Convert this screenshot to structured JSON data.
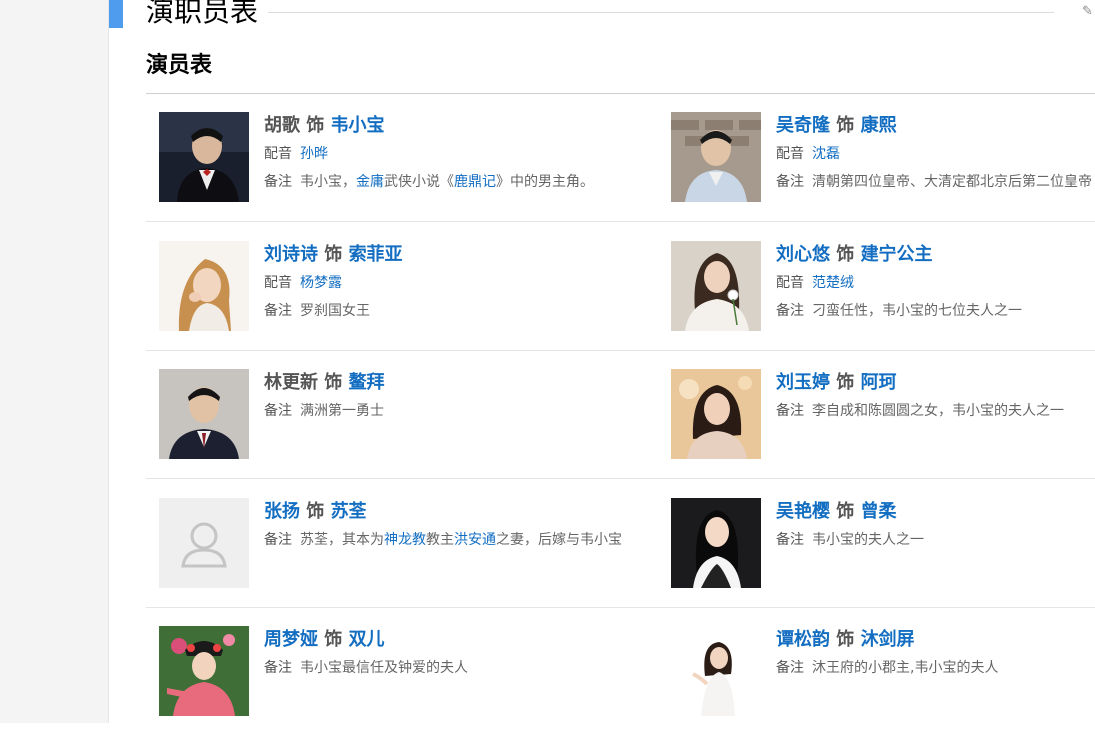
{
  "section": {
    "title": "演职员表",
    "subtitle": "演员表"
  },
  "labels": {
    "dub": "配音",
    "note": "备注",
    "plays": "饰"
  },
  "colors": {
    "link": "#136ec2",
    "accent": "#4f9cee"
  },
  "cast": [
    {
      "actor": "胡歌",
      "role": "韦小宝",
      "dub": "孙晔",
      "note": [
        "韦小宝，",
        "金庸",
        "武侠小说《",
        "鹿鼎记",
        "》中的男主角。"
      ]
    },
    {
      "actor": "吴奇隆",
      "role": "康熙",
      "dub": "沈磊",
      "note": [
        "清朝第四位皇帝、大清定都北京后第二位皇帝"
      ]
    },
    {
      "actor": "刘诗诗",
      "role": "索菲亚",
      "dub": "杨梦露",
      "note": [
        "罗刹国女王"
      ]
    },
    {
      "actor": "刘心悠",
      "role": "建宁公主",
      "dub": "范楚绒",
      "note": [
        "刁蛮任性，韦小宝的七位夫人之一"
      ]
    },
    {
      "actor": "林更新",
      "role": "鳌拜",
      "note": [
        "满洲第一勇士"
      ]
    },
    {
      "actor": "刘玉婷",
      "role": "阿珂",
      "note": [
        "李自成和陈圆圆之女，韦小宝的夫人之一"
      ]
    },
    {
      "actor": "张扬",
      "role": "苏荃",
      "note": [
        "苏荃，其本为",
        "神龙教",
        "教主",
        "洪安通",
        "之妻，后嫁与韦小宝"
      ]
    },
    {
      "actor": "吴艳樱",
      "role": "曾柔",
      "note": [
        "韦小宝的夫人之一"
      ]
    },
    {
      "actor": "周梦娅",
      "role": "双儿",
      "note": [
        "韦小宝最信任及钟爱的夫人"
      ]
    },
    {
      "actor": "谭松韵",
      "role": "沐剑屏",
      "note": [
        "沐王府的小郡主,韦小宝的夫人"
      ]
    }
  ]
}
